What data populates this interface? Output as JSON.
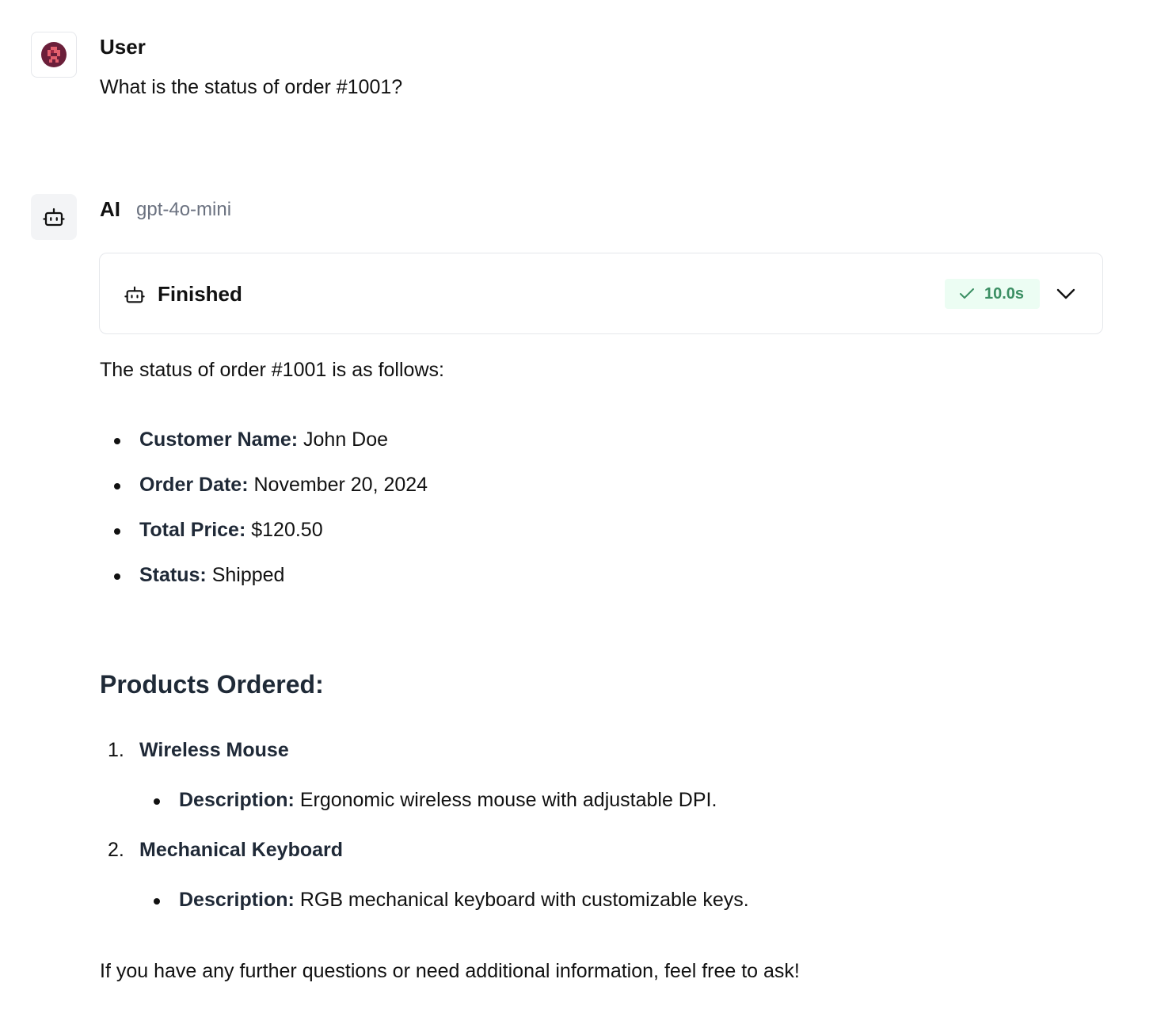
{
  "user_message": {
    "author": "User",
    "text": "What is the status of order #1001?"
  },
  "ai_message": {
    "author": "AI",
    "model": "gpt-4o-mini",
    "run_status": {
      "label": "Finished",
      "duration": "10.0s",
      "badge_color": "#ecfdf3",
      "badge_text_color": "#3b8f63"
    },
    "intro": "The status of order #1001 is as follows:",
    "details": [
      {
        "label": "Customer Name:",
        "value": "John Doe"
      },
      {
        "label": "Order Date:",
        "value": "November 20, 2024"
      },
      {
        "label": "Total Price:",
        "value": "$120.50"
      },
      {
        "label": "Status:",
        "value": "Shipped"
      }
    ],
    "products_heading": "Products Ordered:",
    "products": [
      {
        "number": "1.",
        "name": "Wireless Mouse",
        "desc_label": "Description:",
        "desc": "Ergonomic wireless mouse with adjustable DPI."
      },
      {
        "number": "2.",
        "name": "Mechanical Keyboard",
        "desc_label": "Description:",
        "desc": "RGB mechanical keyboard with customizable keys."
      }
    ],
    "closing": "If you have any further questions or need additional information, feel free to ask!"
  },
  "icons": {
    "user_avatar": "pixel-avatar-icon",
    "ai_avatar": "bot-icon",
    "status": "bot-icon",
    "check": "check-icon",
    "expand": "chevron-down-icon"
  }
}
